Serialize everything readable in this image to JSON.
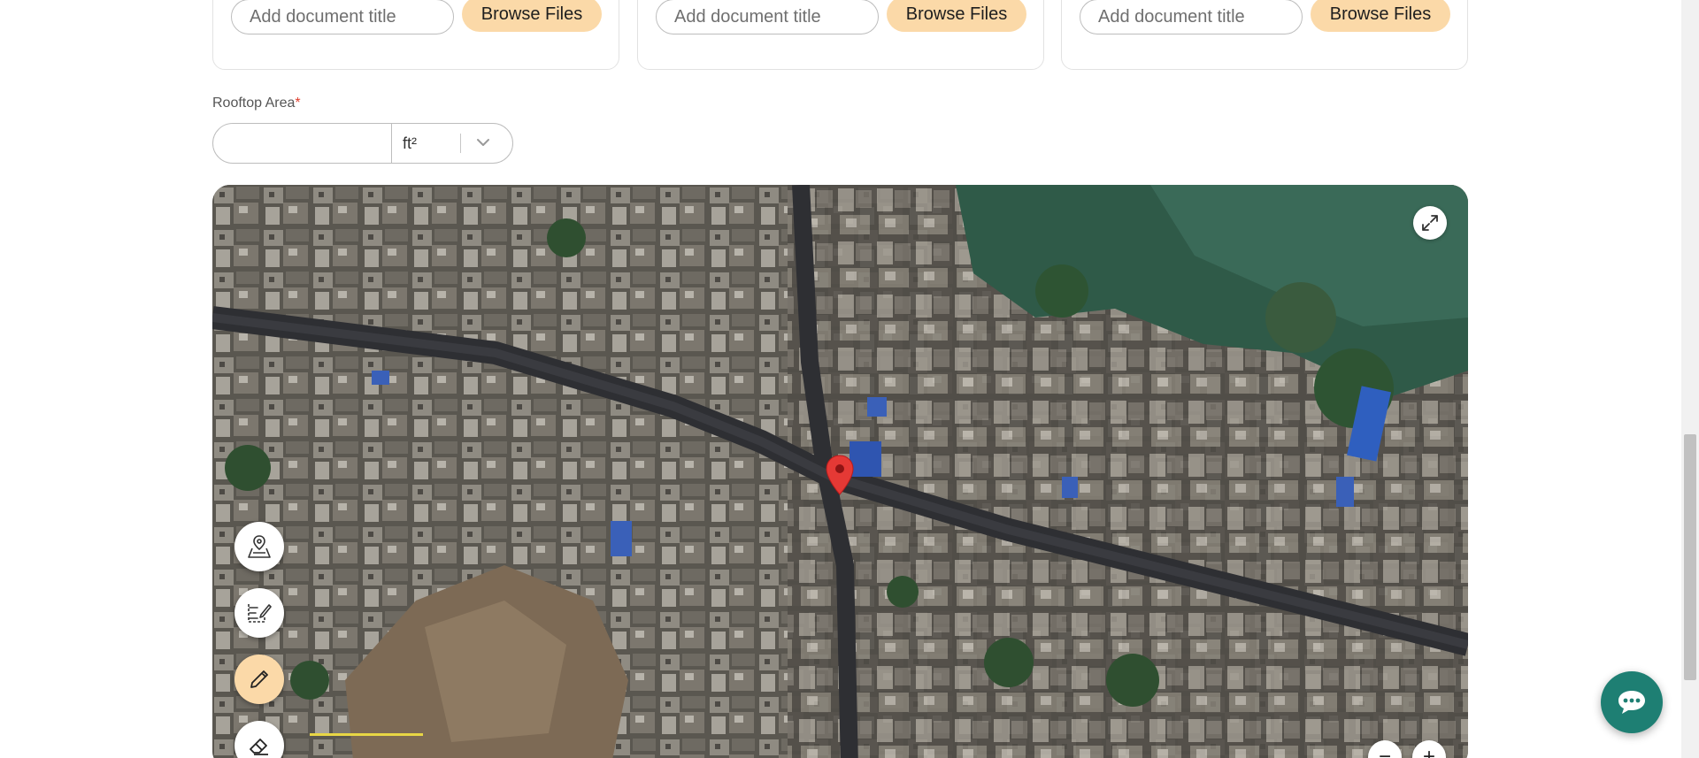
{
  "upload_cards": [
    {
      "title_placeholder": "Add document title",
      "browse_label": "Browse Files"
    },
    {
      "title_placeholder": "Add document title",
      "browse_label": "Browse Files"
    },
    {
      "title_placeholder": "Add document title",
      "browse_label": "Browse Files"
    }
  ],
  "rooftop_area": {
    "label": "Rooftop Area",
    "required_marker": "*",
    "value": "",
    "unit": "ft²"
  },
  "map": {
    "view": "satellite",
    "marker_color": "#e53935",
    "tools": [
      {
        "name": "map-layers-tool",
        "icon": "map-pin-icon",
        "active": false
      },
      {
        "name": "edit-area-tool",
        "icon": "form-edit-icon",
        "active": false
      },
      {
        "name": "draw-tool",
        "icon": "pencil-icon",
        "active": true
      },
      {
        "name": "erase-tool",
        "icon": "eraser-icon",
        "active": false
      }
    ],
    "zoom_out_label": "−",
    "zoom_in_label": "+"
  },
  "colors": {
    "accent": "#fbd9a8",
    "chat_button": "#1e7f73"
  }
}
